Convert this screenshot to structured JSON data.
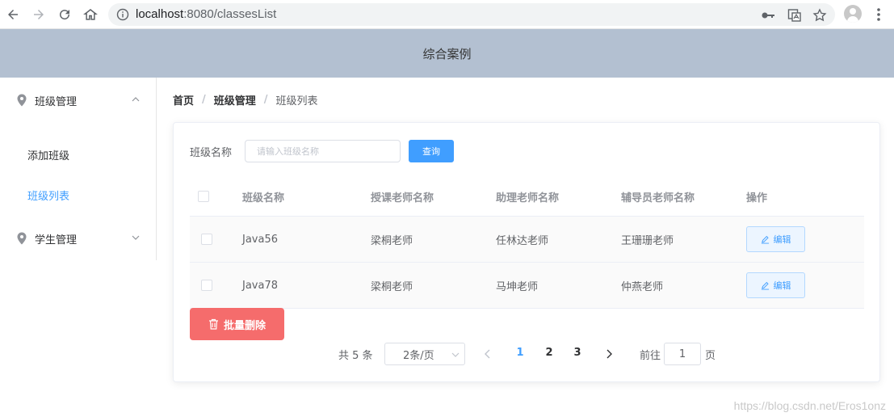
{
  "browser": {
    "url_host": "localhost",
    "url_port_path": ":8080/classesList",
    "icons": [
      "back-icon",
      "forward-icon",
      "reload-icon",
      "home-icon",
      "info-icon",
      "key-icon",
      "translate-icon",
      "star-icon",
      "profile-icon",
      "more-icon"
    ]
  },
  "header": {
    "title": "综合案例"
  },
  "sidebar": {
    "groups": [
      {
        "label": "班级管理",
        "expanded": true,
        "items": [
          {
            "label": "添加班级",
            "active": false
          },
          {
            "label": "班级列表",
            "active": true
          }
        ]
      },
      {
        "label": "学生管理",
        "expanded": false,
        "items": []
      }
    ]
  },
  "breadcrumb": [
    "首页",
    "班级管理",
    "班级列表"
  ],
  "search": {
    "label": "班级名称",
    "placeholder": "请输入班级名称",
    "button": "查询"
  },
  "table": {
    "columns": [
      "班级名称",
      "授课老师名称",
      "助理老师名称",
      "辅导员老师名称",
      "操作"
    ],
    "rows": [
      [
        "Java56",
        "梁桐老师",
        "任林达老师",
        "王珊珊老师"
      ],
      [
        "Java78",
        "梁桐老师",
        "马坤老师",
        "仲燕老师"
      ]
    ],
    "edit_label": "编辑"
  },
  "batch_delete": "批量删除",
  "pagination": {
    "total_text": "共 5 条",
    "page_size": "2条/页",
    "pages": [
      "1",
      "2",
      "3"
    ],
    "current_page": "1",
    "goto_label": "前往",
    "goto_value": "1",
    "page_unit": "页"
  },
  "watermark": "https://blog.csdn.net/Eros1onz",
  "colors": {
    "primary": "#409eff",
    "danger": "#f56c6c",
    "header_bg": "#b3c0d1"
  }
}
